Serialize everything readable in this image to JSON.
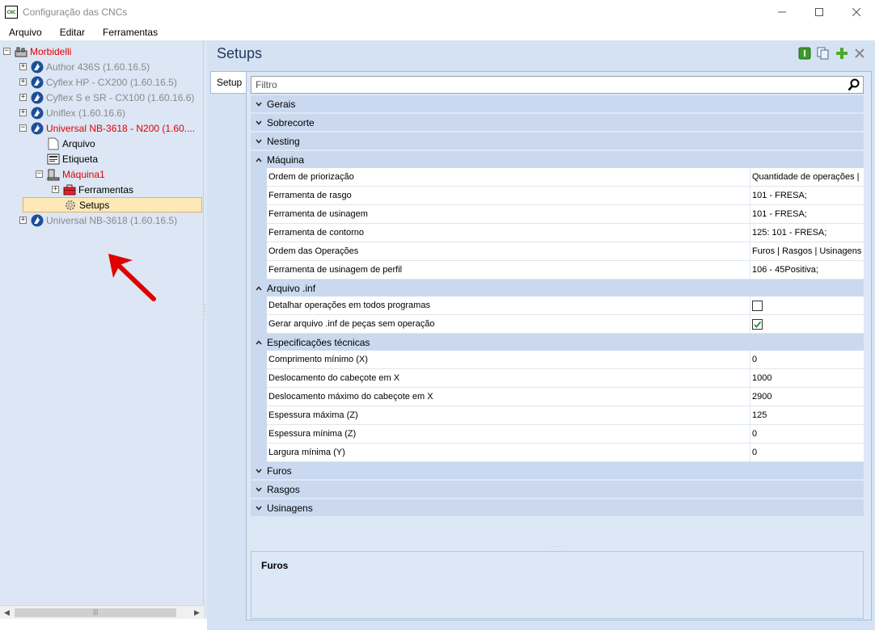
{
  "window": {
    "title": "Configuração das CNCs",
    "icon_label": "CNC"
  },
  "menu": [
    "Arquivo",
    "Editar",
    "Ferramentas"
  ],
  "tree": [
    {
      "label": "Morbidelli",
      "level": 0,
      "expander": "−",
      "color": "red",
      "icon": "factory-icon"
    },
    {
      "label": "Author 436S (1.60.16.5)",
      "level": 1,
      "expander": "+",
      "color": "grey",
      "icon": "machine-blue-icon"
    },
    {
      "label": "Cyflex HP - CX200 (1.60.16.5)",
      "level": 1,
      "expander": "+",
      "color": "grey",
      "icon": "machine-blue-icon"
    },
    {
      "label": "Cyflex S e SR - CX100 (1.60.16.6)",
      "level": 1,
      "expander": "+",
      "color": "grey",
      "icon": "machine-blue-icon"
    },
    {
      "label": "Uniflex (1.60.16.6)",
      "level": 1,
      "expander": "+",
      "color": "grey",
      "icon": "machine-blue-icon"
    },
    {
      "label": "Universal NB-3618 - N200 (1.60....",
      "level": 1,
      "expander": "−",
      "color": "red",
      "icon": "machine-blue-icon"
    },
    {
      "label": "Arquivo",
      "level": 2,
      "expander": "",
      "color": "black",
      "icon": "file-icon"
    },
    {
      "label": "Etiqueta",
      "level": 2,
      "expander": "",
      "color": "black",
      "icon": "label-icon"
    },
    {
      "label": "Máquina1",
      "level": 2,
      "expander": "−",
      "color": "red",
      "icon": "machine-icon"
    },
    {
      "label": "Ferramentas",
      "level": 3,
      "expander": "+",
      "color": "black",
      "icon": "toolbox-icon"
    },
    {
      "label": "Setups",
      "level": 3,
      "expander": "",
      "color": "black",
      "icon": "gear-icon",
      "selected": true
    },
    {
      "label": "Universal NB-3618 (1.60.16.5)",
      "level": 1,
      "expander": "+",
      "color": "grey",
      "icon": "machine-blue-icon"
    }
  ],
  "panel": {
    "title": "Setups",
    "tab": "Setup",
    "filter_placeholder": "Filtro"
  },
  "categories": [
    {
      "label": "Gerais",
      "expanded": false,
      "rows": []
    },
    {
      "label": "Sobrecorte",
      "expanded": false,
      "rows": []
    },
    {
      "label": "Nesting",
      "expanded": false,
      "rows": []
    },
    {
      "label": "Máquina",
      "expanded": true,
      "rows": [
        {
          "name": "Ordem de priorização",
          "value": "Quantidade de operações | "
        },
        {
          "name": "Ferramenta de rasgo",
          "value": "101 - FRESA;"
        },
        {
          "name": "Ferramenta de usinagem",
          "value": "101 - FRESA;"
        },
        {
          "name": "Ferramenta de contorno",
          "value": "125: 101 - FRESA;"
        },
        {
          "name": "Ordem das Operações",
          "value": "Furos | Rasgos | Usinagens |"
        },
        {
          "name": "Ferramenta de usinagem de perfil",
          "value": "106 - 45Positiva;"
        }
      ]
    },
    {
      "label": "Arquivo .inf",
      "expanded": true,
      "rows": [
        {
          "name": "Detalhar operações em todos programas",
          "checkbox": true,
          "checked": false
        },
        {
          "name": "Gerar arquivo .inf de peças sem operação",
          "checkbox": true,
          "checked": true
        }
      ]
    },
    {
      "label": "Especificações técnicas",
      "expanded": true,
      "rows": [
        {
          "name": "Comprimento mínimo (X)",
          "value": "0"
        },
        {
          "name": "Deslocamento do cabeçote em X",
          "value": "1000"
        },
        {
          "name": "Deslocamento máximo do cabeçote em X",
          "value": "2900"
        },
        {
          "name": "Espessura máxima (Z)",
          "value": "125"
        },
        {
          "name": "Espessura mínima (Z)",
          "value": "0"
        },
        {
          "name": "Largura mínima (Y)",
          "value": "0"
        }
      ]
    },
    {
      "label": "Furos",
      "expanded": false,
      "rows": []
    },
    {
      "label": "Rasgos",
      "expanded": false,
      "rows": []
    },
    {
      "label": "Usinagens",
      "expanded": false,
      "rows": []
    }
  ],
  "description": {
    "title": "Furos"
  },
  "colors": {
    "accent_red": "#e00000",
    "panel_bg": "#d5e2f3",
    "category_bg": "#cad9ef"
  }
}
